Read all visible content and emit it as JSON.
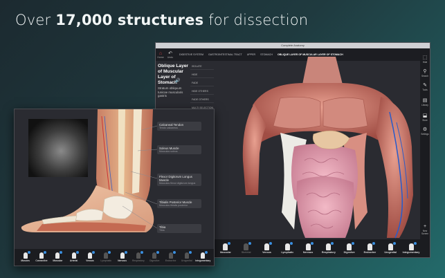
{
  "headline": {
    "pre": "Over ",
    "bold": "17,000 structures",
    "post": " for dissection"
  },
  "window": {
    "title": "Complete Anatomy",
    "nav": [
      {
        "label": "Home",
        "glyph": "⌂"
      },
      {
        "label": "Undo",
        "glyph": "↶"
      }
    ],
    "breadcrumbs": [
      "DIGESTIVE SYSTEM",
      "GASTROINTESTINAL TRACT",
      "UPPER",
      "STOMACH",
      "OBLIQUE LAYER OF MUSCULAR LAYER OF STOMACH"
    ],
    "structure": {
      "title": "Oblique Layer of Muscular Layer of Stomach",
      "latin": "Stratum obliquum tunicae muscularis gastris"
    },
    "actions": [
      "ISOLATE",
      "HIDE",
      "FADE",
      "HIDE OTHERS",
      "FADE OTHERS",
      "MULTI SELECTION"
    ],
    "right_tools": [
      {
        "label": "Hide",
        "glyph": "⬚"
      },
      {
        "label": "Search",
        "glyph": "⚲"
      },
      {
        "label": "Tools",
        "glyph": "✎"
      },
      {
        "label": "Library",
        "glyph": "▤"
      },
      {
        "label": "Store",
        "glyph": "⬓"
      },
      {
        "label": "Settings",
        "glyph": "⚙"
      },
      {
        "label": "New Screen",
        "glyph": "+"
      }
    ],
    "systems": [
      "Muscular",
      "Skeletal",
      "Venous",
      "Lymphatic",
      "Nervous",
      "Respiratory",
      "Digestive",
      "Endocrine",
      "Urogenital",
      "Integumentary"
    ]
  },
  "foot": {
    "labels": [
      {
        "title": "Calcaneal Tendon",
        "latin": "Tendo calcaneus"
      },
      {
        "title": "Soleus Muscle",
        "latin": "Musculus soleus"
      },
      {
        "title": "Flexor Digitorum Longus Muscle",
        "latin": "Musculus flexor digitorum longus"
      },
      {
        "title": "Tibialis Posterior Muscle",
        "latin": "Musculus tibialis posterior"
      },
      {
        "title": "Tibia",
        "latin": "Tibia"
      }
    ],
    "systems": [
      "Muscles",
      "Connective",
      "Muscular",
      "Arterial",
      "Venous",
      "Lymphatic",
      "Nervous",
      "Respiratory",
      "Digestive",
      "Endocrine",
      "Urogenital",
      "Integumentary"
    ]
  }
}
